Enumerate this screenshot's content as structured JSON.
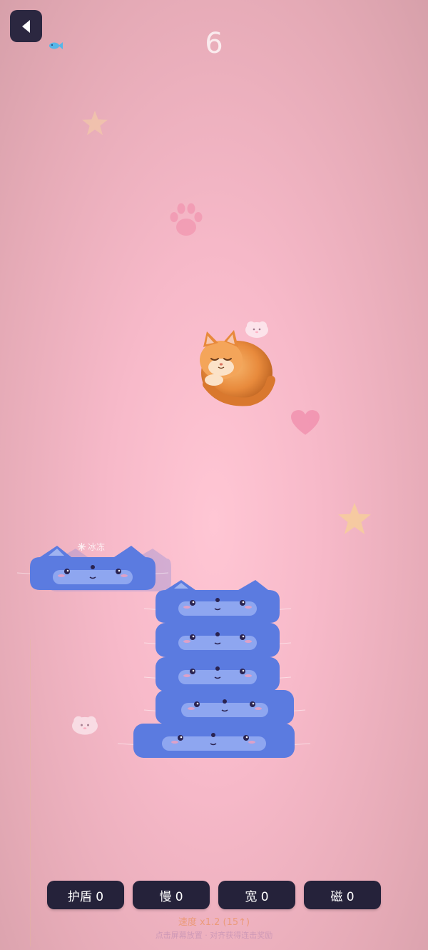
{
  "header": {
    "back_icon": "back-arrow-icon",
    "mini_label": "",
    "fish_icon": "fish-icon",
    "fish_count": "",
    "score": "6"
  },
  "game": {
    "freeze_icon": "snowflake-icon",
    "freeze_label": "冰冻",
    "block_color": "#5b7be0",
    "accent_color": "#ff9fb6",
    "stack_count": 5
  },
  "powerups": [
    {
      "label": "护盾 0"
    },
    {
      "label": "慢 0"
    },
    {
      "label": "宽 0"
    },
    {
      "label": "磁 0"
    }
  ],
  "footer": {
    "speed": "速度 x1.2 (15↑)",
    "hint": "点击屏幕放置 · 对齐获得连击奖励"
  }
}
